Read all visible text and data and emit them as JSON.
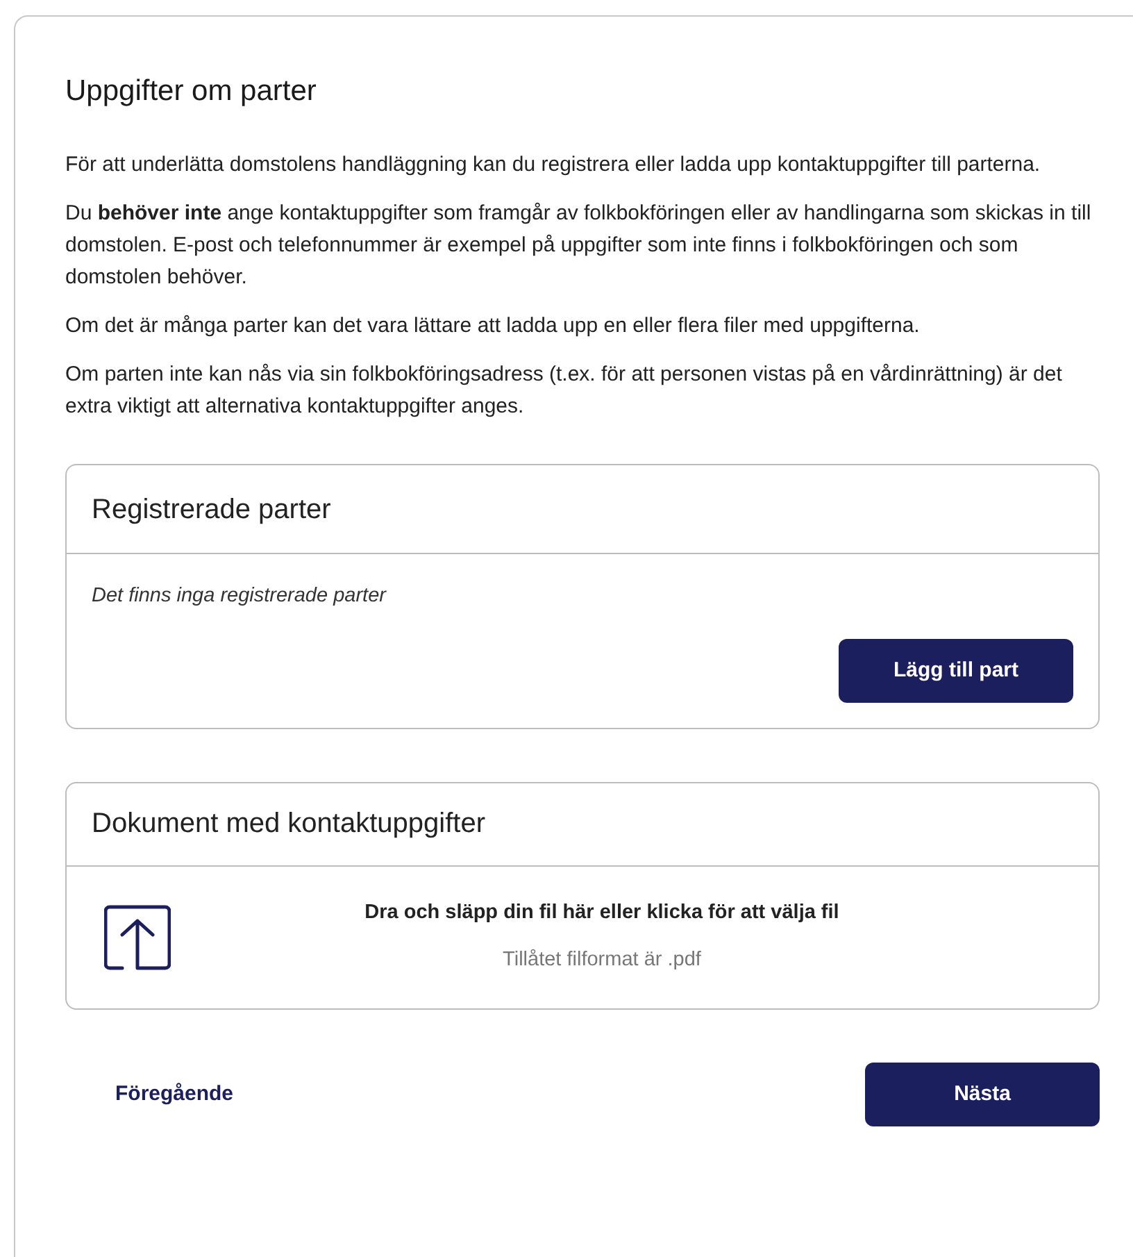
{
  "title": "Uppgifter om parter",
  "paragraphs": [
    "För att underlätta domstolens handläggning kan du registrera eller ladda upp kontaktuppgifter till parterna.",
    "Du **behöver inte** ange kontaktuppgifter som framgår av folkbokföringen eller av handlingarna som skickas in till domstolen. E-post och telefonnummer är exempel på uppgifter som inte finns i folkbokföringen och som domstolen behöver.",
    "Om det är många parter kan det vara lättare att ladda upp en eller flera filer med uppgifterna.",
    "Om parten inte kan nås via sin folkbokföringsadress (t.ex. för att personen vistas på en vårdinrättning) är det extra viktigt att alternativa kontaktuppgifter anges."
  ],
  "registered_parties": {
    "heading": "Registrerade parter",
    "empty_text": "Det finns inga registrerade parter",
    "add_button": "Lägg till part"
  },
  "contact_documents": {
    "heading": "Dokument med kontaktuppgifter",
    "drop_text": "Dra och släpp din fil här eller klicka för att välja fil",
    "format_hint": "Tillåtet filformat är .pdf"
  },
  "navigation": {
    "previous": "Föregående",
    "next": "Nästa"
  }
}
